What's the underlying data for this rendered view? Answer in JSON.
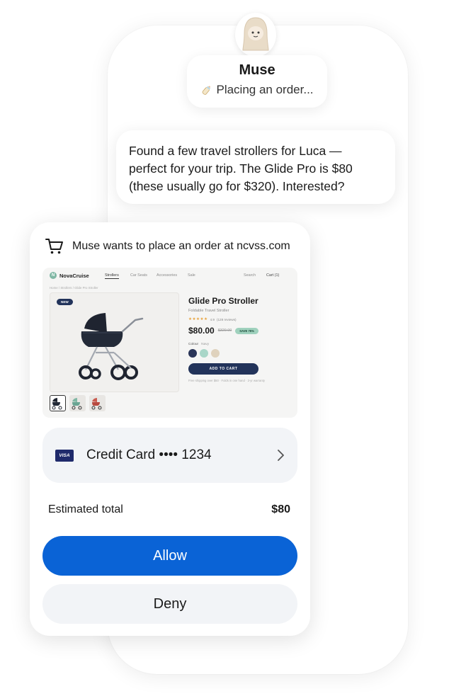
{
  "agent": {
    "name": "Muse",
    "status": "Placing an order..."
  },
  "message": {
    "text": "Found a few travel strollers for Luca — perfect for your trip. The Glide Pro is $80 (these usually go for $320). Interested?"
  },
  "order_request": {
    "title": "Muse wants to place an order at ncvss.com",
    "store": {
      "brand": "NovaCruise",
      "nav": [
        "Strollers",
        "Car Seats",
        "Accessories",
        "Sale"
      ],
      "active_nav": "Strollers",
      "search": "Search",
      "cart": "Cart (1)",
      "breadcrumb": "Home / Strollers / Glide Pro Stroller",
      "badge": "NEW",
      "product": {
        "title": "Glide Pro Stroller",
        "subtitle": "Foldable Travel Stroller",
        "stars": "★★★★★",
        "rating": "4.9",
        "reviews": "(128 reviews)",
        "price": "$80.00",
        "original_price": "$320.00",
        "save_badge": "SAVE 75%",
        "colour_label": "Colour",
        "colour_value": "Navy",
        "colours": [
          "#2a3558",
          "#a9d6c8",
          "#dfd2bd"
        ],
        "add_to_cart": "ADD TO CART",
        "footnote": "Free shipping over $50 · Folds in one hand · 2-yr warranty"
      }
    },
    "payment": {
      "brand": "VISA",
      "label": "Credit Card •••• 1234"
    },
    "total": {
      "label": "Estimated total",
      "value": "$80"
    },
    "actions": {
      "allow": "Allow",
      "deny": "Deny"
    }
  }
}
